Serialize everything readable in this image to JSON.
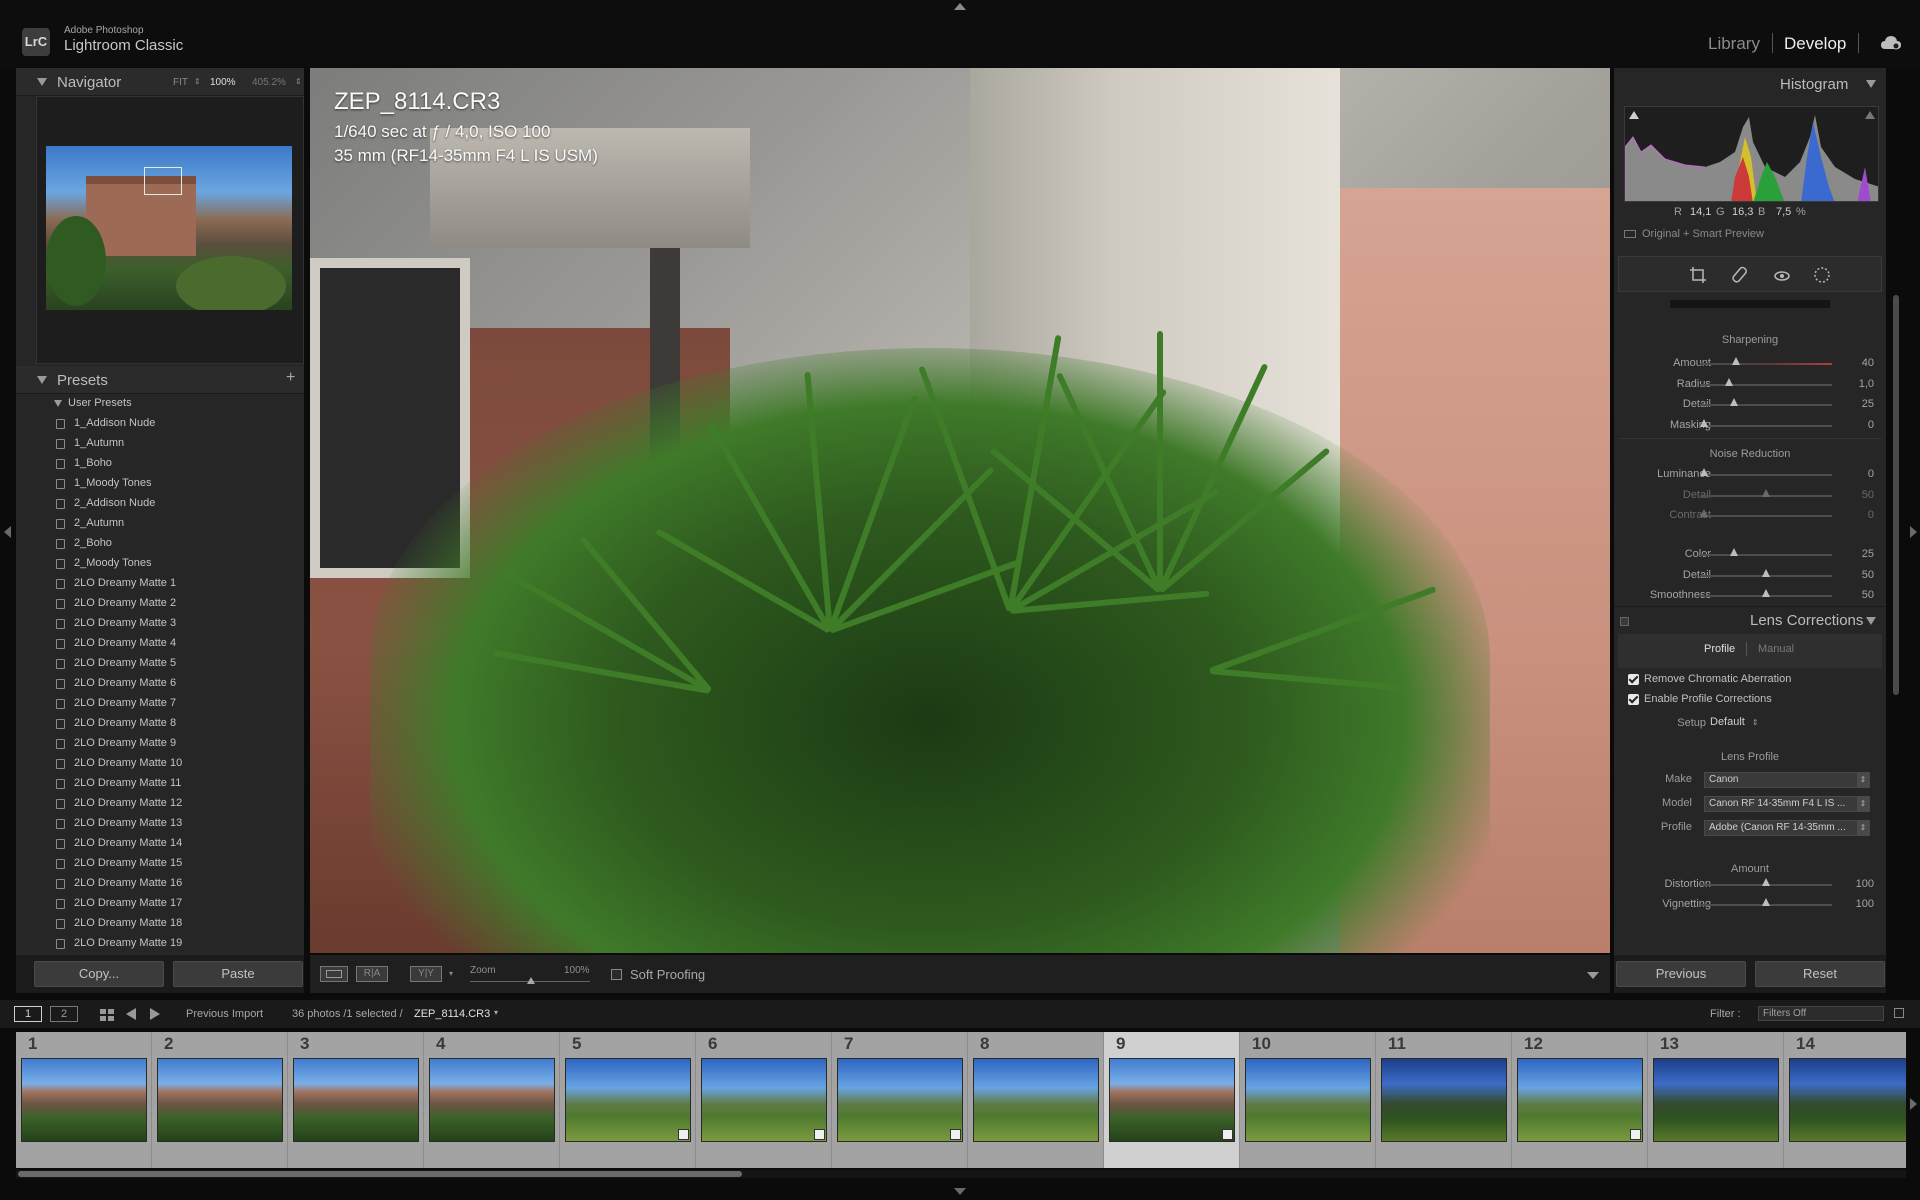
{
  "app": {
    "brand_top": "Adobe Photoshop",
    "brand_main": "Lightroom Classic",
    "logo": "LrC",
    "modules": [
      "Library",
      "Develop"
    ],
    "active_module": "Develop"
  },
  "navigator": {
    "title": "Navigator",
    "zoom_options": [
      "FIT",
      "100%",
      "405.2%"
    ]
  },
  "presets": {
    "title": "Presets",
    "add_icon": "+",
    "group": "User Presets",
    "items": [
      "1_Addison Nude",
      "1_Autumn",
      "1_Boho",
      "1_Moody Tones",
      "2_Addison Nude",
      "2_Autumn",
      "2_Boho",
      "2_Moody Tones",
      "2LO Dreamy Matte 1",
      "2LO Dreamy Matte 2",
      "2LO Dreamy Matte 3",
      "2LO Dreamy Matte 4",
      "2LO Dreamy Matte 5",
      "2LO Dreamy Matte 6",
      "2LO Dreamy Matte 7",
      "2LO Dreamy Matte 8",
      "2LO Dreamy Matte 9",
      "2LO Dreamy Matte 10",
      "2LO Dreamy Matte 11",
      "2LO Dreamy Matte 12",
      "2LO Dreamy Matte 13",
      "2LO Dreamy Matte 14",
      "2LO Dreamy Matte 15",
      "2LO Dreamy Matte 16",
      "2LO Dreamy Matte 17",
      "2LO Dreamy Matte 18",
      "2LO Dreamy Matte 19"
    ]
  },
  "left_buttons": {
    "copy": "Copy...",
    "paste": "Paste"
  },
  "image_info": {
    "filename": "ZEP_8114.CR3",
    "exposure": "1/640 sec at ƒ / 4,0, ISO 100",
    "lens": "35 mm (RF14-35mm F4 L IS USM)"
  },
  "toolbar": {
    "view_single": "",
    "view_ra": "R|A",
    "view_yy": "Y|Y",
    "zoom_label": "Zoom",
    "zoom_value": "100%",
    "soft_proofing": "Soft Proofing",
    "soft_proofing_checked": false
  },
  "histogram": {
    "title": "Histogram",
    "r_label": "R",
    "r_value": "14,1",
    "g_label": "G",
    "g_value": "16,3",
    "b_label": "B",
    "b_value": "7,5",
    "pct": "%",
    "preview_label": "Original + Smart Preview"
  },
  "tools": [
    "crop-icon",
    "healing-icon",
    "red-eye-icon",
    "masking-icon"
  ],
  "sharpening": {
    "title": "Sharpening",
    "sliders": [
      {
        "label": "Amount",
        "value": "40",
        "pos": 0.27
      },
      {
        "label": "Radius",
        "value": "1,0",
        "pos": 0.22
      },
      {
        "label": "Detail",
        "value": "25",
        "pos": 0.26
      },
      {
        "label": "Masking",
        "value": "0",
        "pos": 0.03
      }
    ]
  },
  "noise_reduction": {
    "title": "Noise Reduction",
    "luminance": [
      {
        "label": "Luminance",
        "value": "0",
        "pos": 0.03,
        "dim": false
      },
      {
        "label": "Detail",
        "value": "50",
        "pos": 0.5,
        "dim": true
      },
      {
        "label": "Contrast",
        "value": "0",
        "pos": 0.03,
        "dim": true
      }
    ],
    "color": [
      {
        "label": "Color",
        "value": "25",
        "pos": 0.26,
        "dim": false
      },
      {
        "label": "Detail",
        "value": "50",
        "pos": 0.5,
        "dim": false
      },
      {
        "label": "Smoothness",
        "value": "50",
        "pos": 0.5,
        "dim": false
      }
    ]
  },
  "lens_corrections": {
    "title": "Lens Corrections",
    "tab_profile": "Profile",
    "tab_manual": "Manual",
    "remove_ca": "Remove Chromatic Aberration",
    "enable_profile": "Enable Profile Corrections",
    "setup_label": "Setup",
    "setup_value": "Default",
    "lens_profile_title": "Lens Profile",
    "make_label": "Make",
    "make_value": "Canon",
    "model_label": "Model",
    "model_value": "Canon RF 14-35mm F4 L IS ...",
    "profile_label": "Profile",
    "profile_value": "Adobe (Canon RF 14-35mm ...",
    "amount_title": "Amount",
    "distortion": {
      "label": "Distortion",
      "value": "100",
      "pos": 0.5
    },
    "vignetting": {
      "label": "Vignetting",
      "value": "100",
      "pos": 0.5
    }
  },
  "right_buttons": {
    "previous": "Previous",
    "reset": "Reset"
  },
  "filmbar": {
    "screen1": "1",
    "screen2": "2",
    "source": "Previous Import",
    "count": "36 photos /1 selected /",
    "current_file": "ZEP_8114.CR3",
    "filter_label": "Filter :",
    "filter_value": "Filters Off"
  },
  "filmstrip": {
    "selected": 9,
    "cells": [
      {
        "num": "1",
        "style": "bld",
        "badge": false
      },
      {
        "num": "2",
        "style": "bld",
        "badge": false
      },
      {
        "num": "3",
        "style": "bld",
        "badge": false
      },
      {
        "num": "4",
        "style": "bld",
        "badge": false
      },
      {
        "num": "5",
        "style": "lawn",
        "badge": true
      },
      {
        "num": "6",
        "style": "lawn",
        "badge": true
      },
      {
        "num": "7",
        "style": "lawn",
        "badge": true
      },
      {
        "num": "8",
        "style": "lawn",
        "badge": false
      },
      {
        "num": "9",
        "style": "bld",
        "badge": true
      },
      {
        "num": "10",
        "style": "lawn",
        "badge": false
      },
      {
        "num": "11",
        "style": "dark",
        "badge": false
      },
      {
        "num": "12",
        "style": "lawn",
        "badge": true
      },
      {
        "num": "13",
        "style": "dark",
        "badge": false
      },
      {
        "num": "14",
        "style": "dark",
        "badge": false
      }
    ]
  }
}
